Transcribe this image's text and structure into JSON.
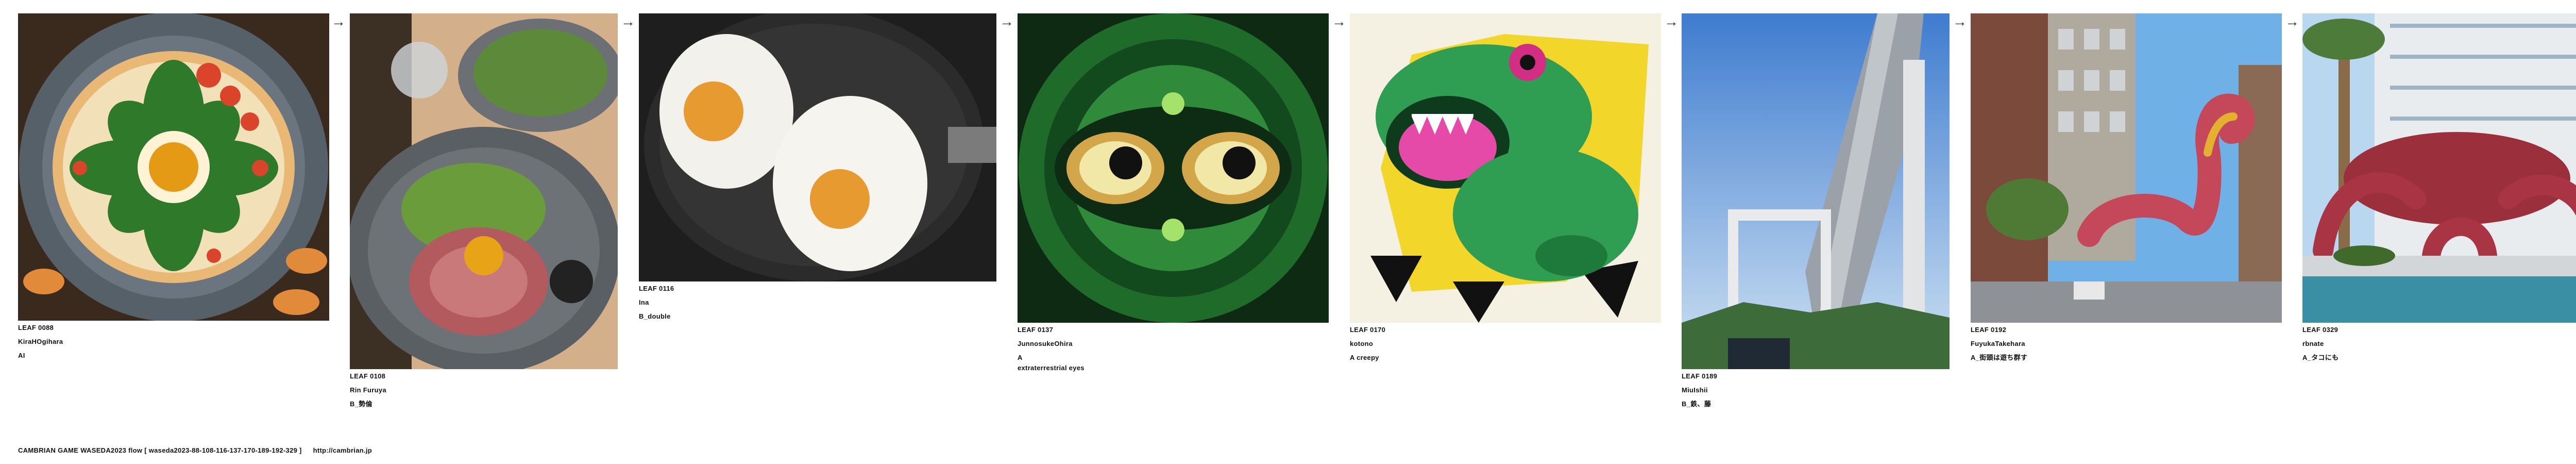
{
  "leaves": [
    {
      "id": "LEAF 0088",
      "author": "KiraHOgihara",
      "desc": "AI",
      "image": "pizza-with-egg-and-herbs-artwork"
    },
    {
      "id": "LEAF 0108",
      "author": "Rin Furuya",
      "desc": "B_勢倫",
      "image": "roast-beef-salad-plate-photo"
    },
    {
      "id": "LEAF 0116",
      "author": "Ina",
      "desc": "B_double",
      "image": "fried-eggs-in-pan-photo"
    },
    {
      "id": "LEAF 0137",
      "author": "JunnosukeOhira",
      "desc": "A\nextraterrestrial eyes",
      "image": "green-alien-eyes-pattern-artwork"
    },
    {
      "id": "LEAF 0170",
      "author": "kotono",
      "desc": "A creepy",
      "image": "green-dinosaur-sticker-artwork"
    },
    {
      "id": "LEAF 0189",
      "author": "MiuIshii",
      "desc": "B_鉄、藤",
      "image": "elevated-highway-blue-sky-photo"
    },
    {
      "id": "LEAF 0192",
      "author": "FuyukaTakehara",
      "desc": "A_街頭は遊ち群す",
      "image": "giant-worm-in-city-street-artwork"
    },
    {
      "id": "LEAF 0329",
      "author": "rbnate",
      "desc": "A_タコにも",
      "image": "giant-octopus-on-building-artwork"
    }
  ],
  "arrow": "→",
  "footer": {
    "title": "CAMBRIAN GAME  WASEDA2023  flow [ waseda2023-88-108-116-137-170-189-192-329 ]",
    "url": "http://cambrian.jp"
  },
  "colors": {
    "background": "#ffffff",
    "text": "#111111"
  }
}
